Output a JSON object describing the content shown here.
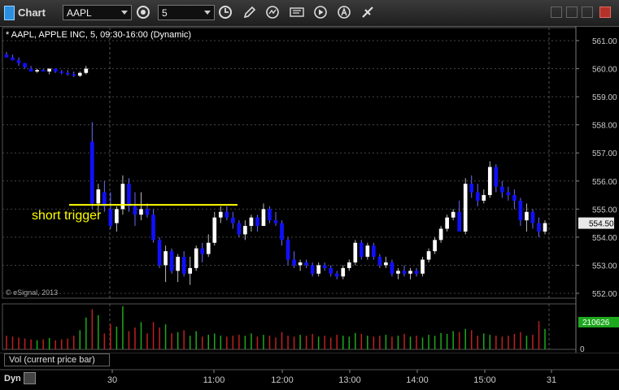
{
  "toolbar": {
    "app_title": "Chart",
    "symbol": "AAPL",
    "interval": "5"
  },
  "chart": {
    "label": "* AAPL, APPLE INC, 5, 09:30-16:00 (Dynamic)",
    "copyright": "© eSignal, 2013",
    "annotation": "short trigger",
    "price_ticks": [
      "561.00",
      "560.00",
      "559.00",
      "558.00",
      "557.00",
      "556.00",
      "555.00",
      "554.00",
      "553.00",
      "552.00"
    ],
    "current_price": "554.50",
    "volume_label": "Vol (current price bar)",
    "volume_value": "210626",
    "volume_zero": "0",
    "time_ticks": [
      "30",
      "11:00",
      "12:00",
      "13:00",
      "14:00",
      "15:00",
      "31"
    ],
    "bottom_label": "Dyn"
  },
  "colors": {
    "up": "#ffffff",
    "down": "#1010ff",
    "vol_up": "#1ea81e",
    "vol_down": "#c02020",
    "trigger": "#ffff00",
    "price_tag": "#e8e8e8"
  },
  "chart_data": {
    "type": "candlestick",
    "symbol": "AAPL",
    "interval": "5",
    "price_range": [
      552.0,
      561.0
    ],
    "trigger_price": 555.15,
    "ohlc": [
      [
        560.5,
        560.6,
        560.4,
        560.4
      ],
      [
        560.4,
        560.5,
        560.3,
        560.3
      ],
      [
        560.3,
        560.4,
        560.1,
        560.2
      ],
      [
        560.2,
        560.2,
        560.0,
        560.05
      ],
      [
        560.0,
        560.1,
        559.9,
        559.9
      ],
      [
        559.9,
        560.0,
        559.85,
        559.95
      ],
      [
        559.95,
        560.0,
        559.9,
        559.9
      ],
      [
        559.9,
        560.0,
        559.8,
        560.0
      ],
      [
        560.0,
        560.0,
        559.85,
        559.9
      ],
      [
        559.9,
        559.95,
        559.8,
        559.85
      ],
      [
        559.85,
        559.95,
        559.75,
        559.8
      ],
      [
        559.8,
        559.9,
        559.7,
        559.75
      ],
      [
        559.75,
        559.9,
        559.7,
        559.85
      ],
      [
        559.85,
        560.1,
        559.8,
        560.0
      ],
      [
        557.4,
        558.1,
        555.0,
        555.2
      ],
      [
        555.2,
        555.9,
        554.8,
        555.7
      ],
      [
        555.6,
        556.0,
        554.9,
        555.1
      ],
      [
        555.0,
        555.6,
        554.3,
        554.4
      ],
      [
        554.5,
        555.1,
        554.2,
        555.0
      ],
      [
        555.0,
        556.2,
        554.8,
        555.9
      ],
      [
        555.9,
        556.1,
        554.9,
        555.1
      ],
      [
        555.1,
        555.6,
        554.4,
        554.8
      ],
      [
        554.8,
        555.6,
        554.6,
        555.0
      ],
      [
        555.0,
        555.2,
        554.7,
        554.8
      ],
      [
        554.8,
        555.0,
        553.8,
        553.9
      ],
      [
        553.9,
        554.0,
        552.9,
        553.0
      ],
      [
        553.0,
        553.7,
        552.4,
        553.5
      ],
      [
        553.5,
        553.6,
        552.7,
        552.8
      ],
      [
        552.8,
        553.4,
        552.4,
        553.3
      ],
      [
        553.3,
        553.5,
        552.6,
        552.7
      ],
      [
        552.7,
        553.3,
        552.3,
        552.9
      ],
      [
        552.9,
        553.7,
        552.8,
        553.6
      ],
      [
        553.6,
        553.8,
        553.1,
        553.4
      ],
      [
        553.4,
        554.1,
        553.3,
        553.8
      ],
      [
        553.8,
        554.9,
        553.7,
        554.7
      ],
      [
        554.7,
        555.1,
        554.5,
        554.9
      ],
      [
        554.9,
        555.1,
        554.6,
        554.7
      ],
      [
        554.7,
        554.9,
        554.3,
        554.5
      ],
      [
        554.5,
        554.6,
        554.0,
        554.1
      ],
      [
        554.1,
        554.6,
        553.9,
        554.4
      ],
      [
        554.4,
        554.8,
        554.2,
        554.7
      ],
      [
        554.7,
        554.8,
        554.2,
        554.4
      ],
      [
        554.4,
        555.2,
        554.4,
        555.0
      ],
      [
        555.0,
        555.1,
        554.5,
        554.6
      ],
      [
        554.6,
        554.9,
        554.4,
        554.5
      ],
      [
        554.5,
        554.6,
        553.7,
        553.9
      ],
      [
        553.9,
        554.0,
        553.0,
        553.2
      ],
      [
        553.2,
        553.5,
        552.9,
        553.0
      ],
      [
        553.0,
        553.2,
        552.8,
        553.1
      ],
      [
        553.1,
        553.2,
        552.9,
        553.0
      ],
      [
        553.0,
        553.1,
        552.6,
        552.7
      ],
      [
        552.7,
        553.1,
        552.6,
        553.0
      ],
      [
        553.0,
        553.1,
        552.8,
        552.9
      ],
      [
        552.9,
        553.0,
        552.6,
        552.7
      ],
      [
        552.7,
        552.8,
        552.5,
        552.6
      ],
      [
        552.6,
        553.0,
        552.5,
        552.9
      ],
      [
        552.9,
        553.2,
        552.8,
        553.1
      ],
      [
        553.1,
        553.9,
        553.0,
        553.8
      ],
      [
        553.8,
        553.9,
        553.2,
        553.3
      ],
      [
        553.3,
        553.8,
        553.2,
        553.7
      ],
      [
        553.7,
        553.8,
        553.2,
        553.3
      ],
      [
        553.3,
        553.4,
        552.9,
        553.0
      ],
      [
        553.0,
        553.3,
        552.9,
        553.1
      ],
      [
        553.1,
        553.2,
        552.6,
        552.7
      ],
      [
        552.7,
        552.9,
        552.5,
        552.8
      ],
      [
        552.8,
        553.0,
        552.6,
        552.7
      ],
      [
        552.7,
        552.9,
        552.5,
        552.8
      ],
      [
        552.8,
        552.9,
        552.6,
        552.7
      ],
      [
        552.7,
        553.3,
        552.6,
        553.2
      ],
      [
        553.2,
        553.6,
        553.1,
        553.5
      ],
      [
        553.5,
        554.0,
        553.4,
        553.9
      ],
      [
        553.9,
        554.4,
        553.8,
        554.3
      ],
      [
        554.3,
        554.8,
        554.2,
        554.7
      ],
      [
        554.7,
        555.0,
        554.6,
        554.9
      ],
      [
        554.9,
        555.3,
        554.8,
        554.2
      ],
      [
        554.2,
        556.1,
        554.1,
        555.9
      ],
      [
        555.9,
        556.2,
        555.4,
        555.6
      ],
      [
        555.6,
        555.9,
        555.1,
        555.3
      ],
      [
        555.3,
        555.7,
        555.2,
        555.5
      ],
      [
        555.5,
        556.7,
        555.4,
        556.5
      ],
      [
        556.5,
        556.6,
        555.6,
        555.8
      ],
      [
        555.8,
        556.0,
        555.4,
        555.6
      ],
      [
        555.6,
        555.8,
        555.3,
        555.5
      ],
      [
        555.5,
        555.7,
        555.0,
        555.3
      ],
      [
        555.3,
        555.4,
        554.4,
        554.6
      ],
      [
        554.6,
        555.2,
        554.2,
        554.9
      ],
      [
        554.9,
        555.0,
        554.3,
        554.5
      ],
      [
        554.5,
        554.7,
        554.0,
        554.2
      ],
      [
        554.2,
        554.6,
        554.1,
        554.5
      ]
    ],
    "volume": [
      0.3,
      0.28,
      0.26,
      0.24,
      0.22,
      0.2,
      0.22,
      0.25,
      0.2,
      0.22,
      0.24,
      0.3,
      0.42,
      0.7,
      0.88,
      0.75,
      0.35,
      0.55,
      0.5,
      0.95,
      0.4,
      0.48,
      0.6,
      0.35,
      0.6,
      0.48,
      0.55,
      0.35,
      0.38,
      0.42,
      0.3,
      0.4,
      0.28,
      0.32,
      0.35,
      0.3,
      0.28,
      0.3,
      0.32,
      0.3,
      0.35,
      0.28,
      0.32,
      0.3,
      0.26,
      0.38,
      0.3,
      0.28,
      0.32,
      0.3,
      0.34,
      0.28,
      0.3,
      0.26,
      0.32,
      0.3,
      0.28,
      0.36,
      0.34,
      0.3,
      0.28,
      0.3,
      0.32,
      0.28,
      0.3,
      0.34,
      0.28,
      0.3,
      0.26,
      0.32,
      0.3,
      0.36,
      0.34,
      0.4,
      0.38,
      0.45,
      0.42,
      0.3,
      0.35,
      0.32,
      0.3,
      0.28,
      0.3,
      0.34,
      0.38,
      0.3,
      0.32,
      0.62,
      0.45
    ]
  }
}
